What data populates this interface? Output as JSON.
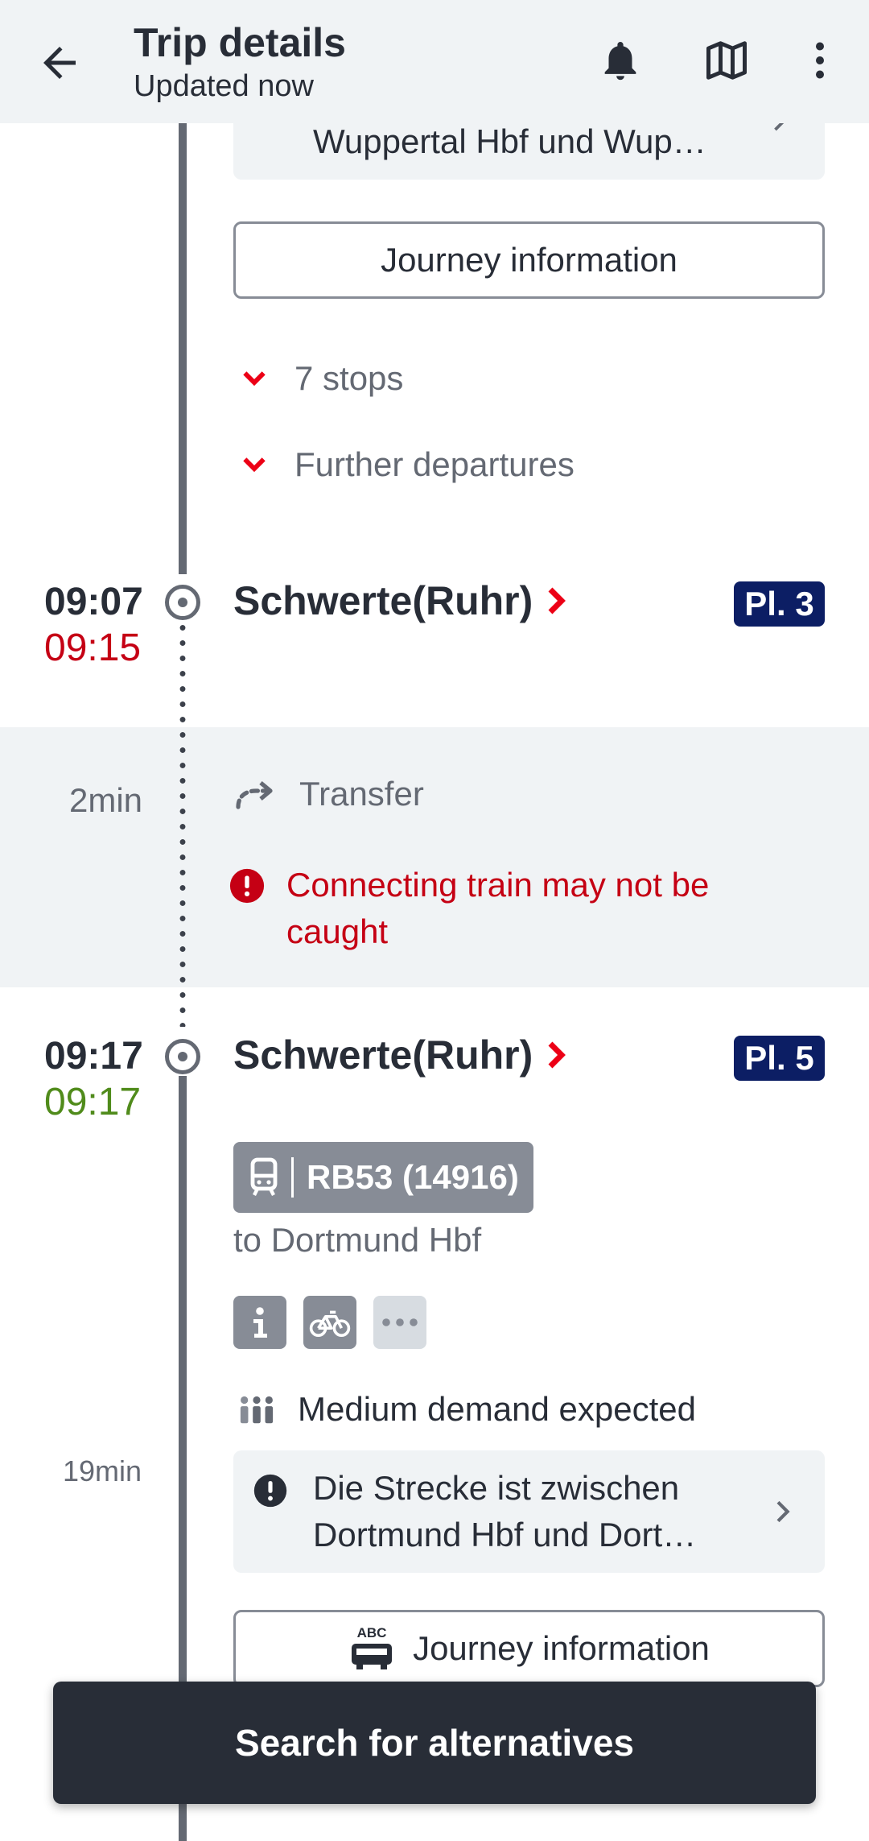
{
  "appbar": {
    "title": "Trip details",
    "subtitle": "Updated now",
    "icons": [
      "back-arrow-icon",
      "bell-icon",
      "map-icon",
      "more-vert-icon"
    ]
  },
  "leg1": {
    "notice_text": "Wuppertal Hbf und Wup…",
    "journey_info_label": "Journey information",
    "stops_label": "7 stops",
    "further_departures_label": "Further departures"
  },
  "arrival": {
    "time_planned": "09:07",
    "time_actual": "09:15",
    "station": "Schwerte(Ruhr)",
    "platform": "Pl. 3"
  },
  "transfer": {
    "duration": "2min",
    "label": "Transfer",
    "warning": "Connecting train may not be caught"
  },
  "departure": {
    "time_planned": "09:17",
    "time_actual": "09:17",
    "station": "Schwerte(Ruhr)",
    "platform": "Pl. 5",
    "train": "RB53 (14916)",
    "destination": "to Dortmund Hbf",
    "amenities": [
      "info-icon",
      "bicycle-icon",
      "more-horiz-icon"
    ],
    "demand": "Medium demand expected",
    "duration": "19min",
    "notice_line1": "Die Strecke ist zwischen",
    "notice_line2": "Dortmund Hbf und Dort…",
    "journey_info_label": "Journey information"
  },
  "actions": {
    "search_alternatives": "Search for alternatives"
  },
  "colors": {
    "delay_red": "#c50014",
    "ontime_green": "#508b1b",
    "platform_navy": "#0c1e64",
    "accent_red": "#ec0016"
  }
}
